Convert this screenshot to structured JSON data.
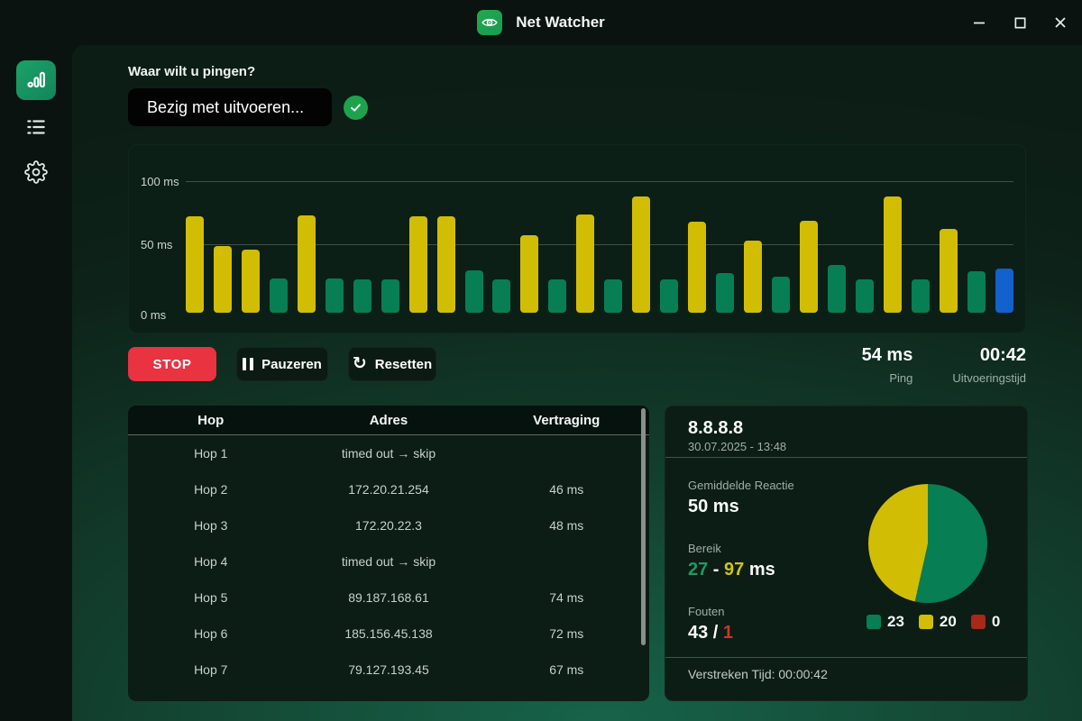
{
  "app": {
    "title": "Net Watcher"
  },
  "ping_section": {
    "label": "Waar wilt u pingen?",
    "input_value": "Bezig met uitvoeren..."
  },
  "chart_data": {
    "type": "bar",
    "unit": "ms",
    "ylim": [
      0,
      100
    ],
    "y_ticks": [
      "100 ms",
      "50 ms",
      "0 ms"
    ],
    "grid": true,
    "colors": {
      "fast": "#077e53",
      "slow": "#d1bd04",
      "current": "#1261cc"
    },
    "points": [
      {
        "ms": 72,
        "state": "slow"
      },
      {
        "ms": 50,
        "state": "slow"
      },
      {
        "ms": 47,
        "state": "slow"
      },
      {
        "ms": 26,
        "state": "fast"
      },
      {
        "ms": 73,
        "state": "slow"
      },
      {
        "ms": 26,
        "state": "fast"
      },
      {
        "ms": 25,
        "state": "fast"
      },
      {
        "ms": 25,
        "state": "fast"
      },
      {
        "ms": 72,
        "state": "slow"
      },
      {
        "ms": 72,
        "state": "slow"
      },
      {
        "ms": 32,
        "state": "fast"
      },
      {
        "ms": 25,
        "state": "fast"
      },
      {
        "ms": 58,
        "state": "slow"
      },
      {
        "ms": 25,
        "state": "fast"
      },
      {
        "ms": 74,
        "state": "slow"
      },
      {
        "ms": 25,
        "state": "fast"
      },
      {
        "ms": 87,
        "state": "slow"
      },
      {
        "ms": 25,
        "state": "fast"
      },
      {
        "ms": 68,
        "state": "slow"
      },
      {
        "ms": 30,
        "state": "fast"
      },
      {
        "ms": 54,
        "state": "slow"
      },
      {
        "ms": 27,
        "state": "fast"
      },
      {
        "ms": 69,
        "state": "slow"
      },
      {
        "ms": 36,
        "state": "fast"
      },
      {
        "ms": 25,
        "state": "fast"
      },
      {
        "ms": 87,
        "state": "slow"
      },
      {
        "ms": 25,
        "state": "fast"
      },
      {
        "ms": 63,
        "state": "slow"
      },
      {
        "ms": 31,
        "state": "fast"
      },
      {
        "ms": 33,
        "state": "current"
      }
    ]
  },
  "controls": {
    "stop": "STOP",
    "pause": "Pauzeren",
    "reset": "Resetten"
  },
  "live_stats": {
    "ping_value": "54 ms",
    "ping_label": "Ping",
    "elapsed_value": "00:42",
    "elapsed_label": "Uitvoeringstijd"
  },
  "hops_table": {
    "headers": [
      "Hop",
      "Adres",
      "Vertraging"
    ],
    "rows": [
      [
        "Hop 1",
        "timed out → skip",
        ""
      ],
      [
        "Hop 2",
        "172.20.21.254",
        "46 ms"
      ],
      [
        "Hop 3",
        "172.20.22.3",
        "48 ms"
      ],
      [
        "Hop 4",
        "timed out → skip",
        ""
      ],
      [
        "Hop 5",
        "89.187.168.61",
        "74 ms"
      ],
      [
        "Hop 6",
        "185.156.45.138",
        "72 ms"
      ],
      [
        "Hop 7",
        "79.127.193.45",
        "67 ms"
      ]
    ]
  },
  "target_panel": {
    "ip": "8.8.8.8",
    "timestamp": "30.07.2025 - 13:48",
    "avg": {
      "label": "Gemiddelde Reactie",
      "value": "50 ms"
    },
    "range": {
      "label": "Bereik",
      "min": "27",
      "sep": " - ",
      "max": "97",
      "unit": " ms"
    },
    "errors": {
      "label": "Fouten",
      "ok": "43",
      "sep": " / ",
      "fail": "1"
    },
    "pie": {
      "slices": [
        {
          "name": "fast",
          "value": 23,
          "color": "#077e53"
        },
        {
          "name": "slow",
          "value": 20,
          "color": "#d1bd04"
        },
        {
          "name": "error",
          "value": 0,
          "color": "#a8281a"
        }
      ]
    },
    "elapsed": "Verstreken Tijd: 00:00:42"
  }
}
